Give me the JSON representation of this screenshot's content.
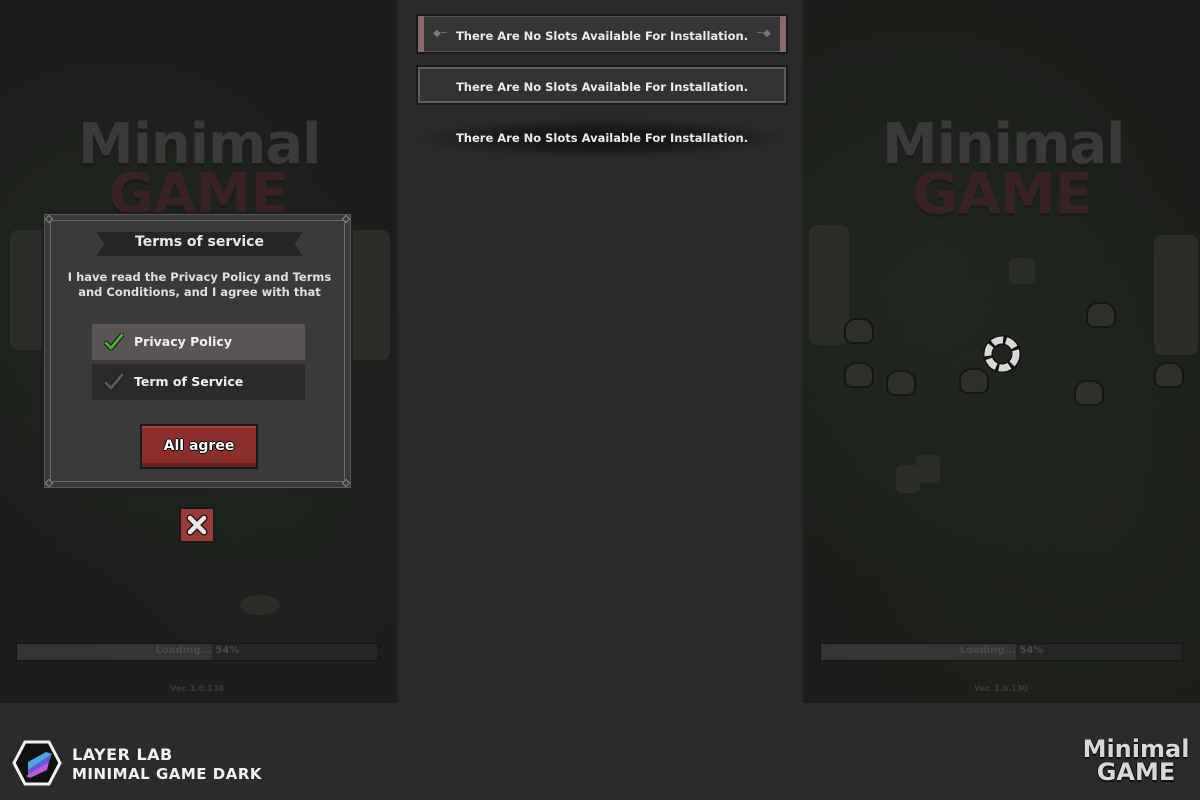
{
  "modal": {
    "title": "Terms of service",
    "description": "I have read the Privacy Policy and Terms and Conditions, and I agree with that",
    "options": [
      {
        "label": "Privacy Policy",
        "checked": true
      },
      {
        "label": "Term of Service",
        "checked": false
      }
    ],
    "agree_label": "All agree"
  },
  "logo": {
    "line1": "Minimal",
    "line2": "GAME"
  },
  "loading": {
    "text": "Loading... 54%",
    "progress": 0.54
  },
  "version": "Ver. 1.0.130",
  "toasts": [
    "There Are No Slots Available For Installation.",
    "There Are No Slots Available For Installation.",
    "There Are No Slots Available For Installation."
  ],
  "footer": {
    "brand_name": "LAYER LAB",
    "brand_sub": "MINIMAL GAME DARK",
    "logo_line1": "Minimal",
    "logo_line2": "GAME"
  },
  "colors": {
    "accent_red": "#8c2f2c",
    "check_green": "#4caf2e",
    "panel_bg": "#3a3a3a"
  },
  "icons": [
    "check-icon",
    "close-icon",
    "loading-spinner-icon",
    "layer-lab-logo-icon"
  ]
}
